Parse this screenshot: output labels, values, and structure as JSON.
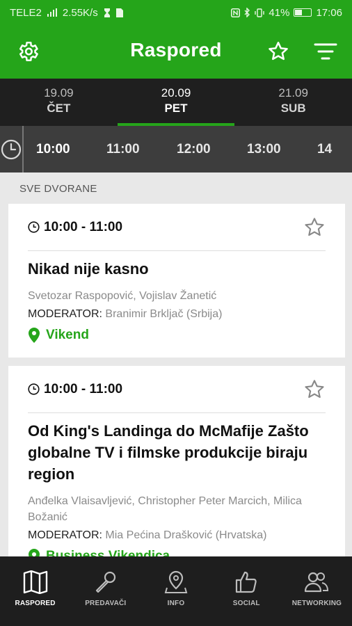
{
  "status": {
    "carrier": "TELE2",
    "speed": "2.55K/s",
    "battery": "41%",
    "time": "17:06"
  },
  "appbar": {
    "title": "Raspored",
    "settings_icon": "gear-icon",
    "favorite_icon": "star-outline-icon",
    "filter_icon": "filter-lines-icon"
  },
  "dates": [
    {
      "date": "19.09",
      "day": "ČET"
    },
    {
      "date": "20.09",
      "day": "PET"
    },
    {
      "date": "21.09",
      "day": "SUB"
    }
  ],
  "times": [
    "10:00",
    "11:00",
    "12:00",
    "13:00",
    "14"
  ],
  "section_label": "SVE DVORANE",
  "events": [
    {
      "time": "10:00 - 11:00",
      "title": "Nikad nije kasno",
      "speakers": "Svetozar Raspopović, Vojislav Žanetić",
      "moderator_label": "MODERATOR:",
      "moderator": "Branimir Brkljač (Srbija)",
      "venue": "Vikend"
    },
    {
      "time": "10:00 - 11:00",
      "title": "Od King's Landinga do McMafije Zašto globalne TV i filmske produkcije biraju region",
      "speakers": "Anđelka Vlaisavljević, Christopher Peter Marcich, Milica Božanić",
      "moderator_label": "MODERATOR:",
      "moderator": "Mia Pećina Drašković (Hrvatska)",
      "venue": "Business Vikendica"
    }
  ],
  "nav": [
    {
      "label": "RASPORED",
      "icon": "map-icon"
    },
    {
      "label": "PREDAVAČI",
      "icon": "microphone-icon"
    },
    {
      "label": "INFO",
      "icon": "location-pin-icon"
    },
    {
      "label": "SOCIAL",
      "icon": "thumbs-up-icon"
    },
    {
      "label": "NETWORKING",
      "icon": "people-icon"
    }
  ],
  "colors": {
    "accent": "#25a51a",
    "dark": "#1f1f1f"
  }
}
